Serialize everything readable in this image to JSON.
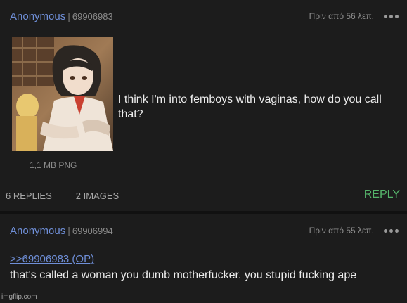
{
  "op_post": {
    "name": "Anonymous",
    "separator": "|",
    "post_number": "69906983",
    "timestamp": "Πριν από 56 λεπ.",
    "menu_icon": "more-dots-icon",
    "text": "I think I'm into femboys with vaginas, how do you call that?",
    "file_info": "1,1 MB PNG",
    "replies_count": "6 REPLIES",
    "images_count": "2 IMAGES",
    "reply_label": "REPLY"
  },
  "reply_post": {
    "name": "Anonymous",
    "separator": "|",
    "post_number": "69906994",
    "timestamp": "Πριν από 55 λεπ.",
    "menu_icon": "more-dots-icon",
    "quote": ">>69906983 (OP)",
    "text": "that's called a woman you dumb motherfucker. you stupid fucking ape"
  },
  "watermark": "imgflip.com",
  "colors": {
    "background": "#1c1c1c",
    "name": "#6f8fd8",
    "reply_button": "#55b36a",
    "text": "#ececec"
  }
}
